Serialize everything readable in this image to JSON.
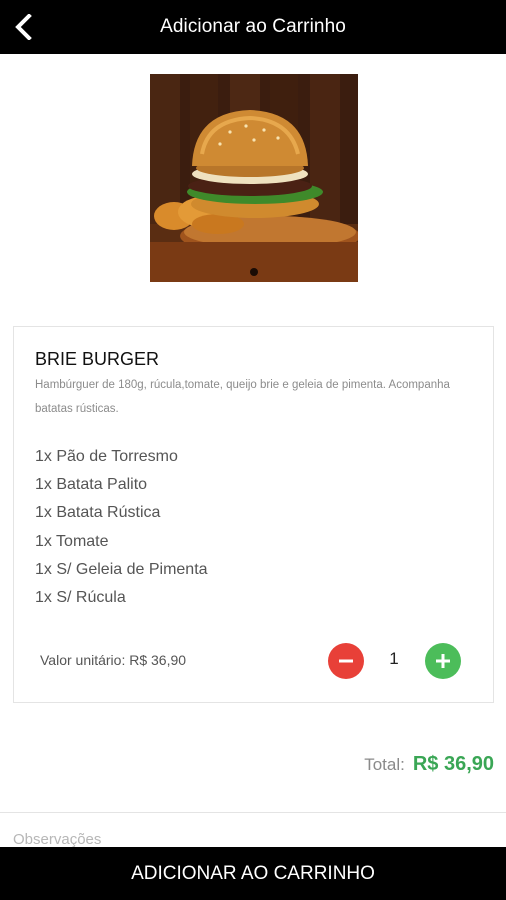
{
  "header": {
    "title": "Adicionar ao Carrinho",
    "back_icon": "chevron-left-icon"
  },
  "product": {
    "name": "BRIE BURGER",
    "description": "Hambúrguer de 180g, rúcula,tomate, queijo brie e geleia de pimenta. Acompanha batatas rústicas.",
    "image": "burger-photo",
    "options": [
      "1x Pão de Torresmo",
      "1x Batata Palito",
      "1x Batata Rústica",
      "1x Tomate",
      "1x S/ Geleia de Pimenta",
      "1x S/ Rúcula"
    ],
    "unit_price": "Valor unitário: R$ 36,90",
    "quantity": "1"
  },
  "total": {
    "label": "Total:",
    "value": "R$ 36,90"
  },
  "notes": {
    "placeholder": "Observações",
    "value": ""
  },
  "footer": {
    "button_label": "ADICIONAR AO CARRINHO"
  },
  "colors": {
    "bar": "#000000",
    "minus": "#e84038",
    "plus": "#4cbd5a",
    "total": "#3aa655"
  }
}
